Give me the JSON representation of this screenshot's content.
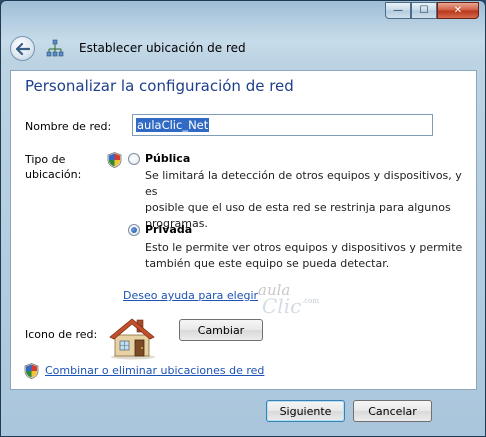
{
  "window": {
    "caption_buttons": {
      "minimize": "—",
      "maximize": "☐",
      "close": "✕"
    },
    "title": "Establecer ubicación de red"
  },
  "heading": "Personalizar la configuración de red",
  "network_name": {
    "label": "Nombre de red:",
    "value": "aulaClic_Net"
  },
  "location_type": {
    "label_line1": "Tipo de",
    "label_line2": "ubicación:",
    "options": [
      {
        "label": "Pública",
        "selected": false,
        "description": [
          "Se limitará la detección de otros equipos y dispositivos, y es",
          "posible que el uso de esta red se restrinja para algunos",
          "programas."
        ]
      },
      {
        "label": "Privada",
        "selected": true,
        "description": [
          "Esto le permite ver otros equipos y dispositivos y permite",
          "también que este equipo se pueda detectar."
        ]
      }
    ]
  },
  "help_link": "Deseo ayuda para elegir",
  "watermark": {
    "line1": "aula",
    "line2": "Clic",
    "line3": ".com"
  },
  "network_icon": {
    "label": "Icono de red:",
    "change_button": "Cambiar",
    "icon": "house-icon"
  },
  "merge_link": "Combinar o eliminar ubicaciones de red",
  "footer": {
    "next_button": "Siguiente",
    "cancel_button": "Cancelar"
  },
  "colors": {
    "heading": "#1e3f8a",
    "link": "#1d53b5",
    "selection": "#316ac5"
  }
}
